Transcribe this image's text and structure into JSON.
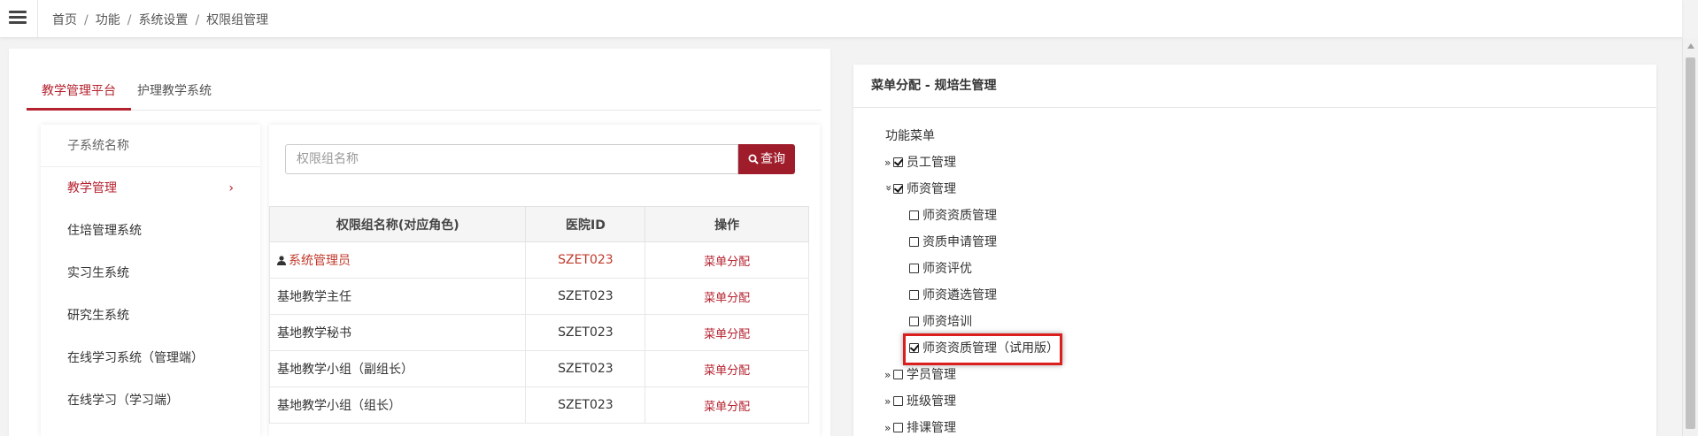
{
  "breadcrumb": [
    "首页",
    "功能",
    "系统设置",
    "权限组管理"
  ],
  "tabs": [
    {
      "label": "教学管理平台",
      "active": true
    },
    {
      "label": "护理教学系统",
      "active": false
    }
  ],
  "subsystem": {
    "header": "子系统名称",
    "items": [
      "教学管理",
      "住培管理系统",
      "实习生系统",
      "研究生系统",
      "在线学习系统（管理端）",
      "在线学习（学习端）"
    ],
    "active_index": 0
  },
  "search": {
    "placeholder": "权限组名称",
    "button_label": "查询"
  },
  "table": {
    "headers": [
      "权限组名称(对应角色)",
      "医院ID",
      "操作"
    ],
    "rows": [
      {
        "name": "系统管理员",
        "hospital_id": "SZET023",
        "action": "菜单分配",
        "highlight": true
      },
      {
        "name": "基地教学主任",
        "hospital_id": "SZET023",
        "action": "菜单分配"
      },
      {
        "name": "基地教学秘书",
        "hospital_id": "SZET023",
        "action": "菜单分配"
      },
      {
        "name": "基地教学小组（副组长）",
        "hospital_id": "SZET023",
        "action": "菜单分配"
      },
      {
        "name": "基地教学小组（组长）",
        "hospital_id": "SZET023",
        "action": "菜单分配"
      }
    ]
  },
  "menu_panel": {
    "title": "菜单分配 - 规培生管理",
    "root_label": "功能菜单",
    "items": [
      {
        "label": "员工管理",
        "checked": true,
        "level": 0,
        "expander": "»"
      },
      {
        "label": "师资管理",
        "checked": true,
        "level": 0,
        "expander": "»",
        "expanded": true
      },
      {
        "label": "师资资质管理",
        "checked": false,
        "level": 1
      },
      {
        "label": "资质申请管理",
        "checked": false,
        "level": 1
      },
      {
        "label": "师资评优",
        "checked": false,
        "level": 1
      },
      {
        "label": "师资遴选管理",
        "checked": false,
        "level": 1
      },
      {
        "label": "师资培训",
        "checked": false,
        "level": 1
      },
      {
        "label": "师资资质管理（试用版）",
        "checked": true,
        "level": 1,
        "highlighted": true
      },
      {
        "label": "学员管理",
        "checked": false,
        "level": 0,
        "expander": "»"
      },
      {
        "label": "班级管理",
        "checked": false,
        "level": 0,
        "expander": "»"
      },
      {
        "label": "排课管理",
        "checked": false,
        "level": 0,
        "expander": "»"
      }
    ]
  },
  "colors": {
    "accent": "#b5222f",
    "button": "#9f1d2b",
    "highlight_box": "#d9201f"
  }
}
